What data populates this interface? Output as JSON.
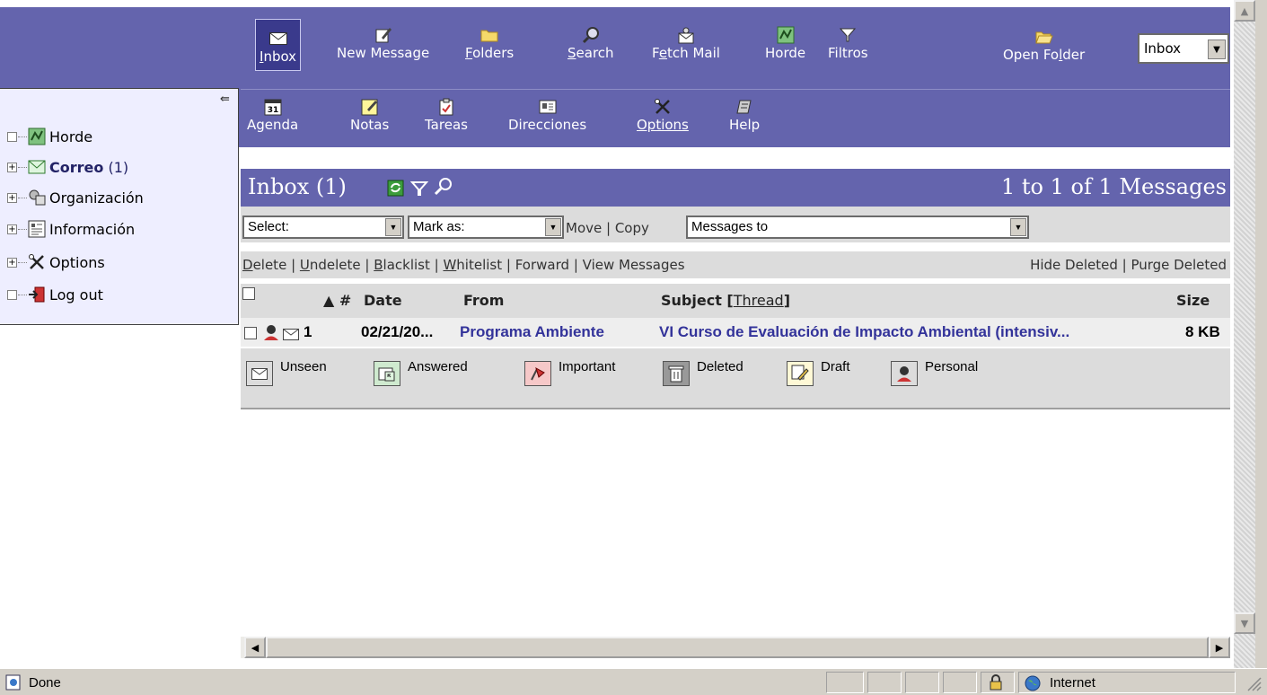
{
  "toolbar": {
    "row1": [
      {
        "name": "inbox",
        "icon": "envelope-icon",
        "prefix": "",
        "underline": "I",
        "suffix": "nbox"
      },
      {
        "name": "new-message",
        "icon": "compose-icon",
        "prefix": "",
        "underline": "",
        "suffix": "New Message"
      },
      {
        "name": "folders",
        "icon": "folder-icon",
        "prefix": "",
        "underline": "F",
        "suffix": "olders"
      },
      {
        "name": "search",
        "icon": "search-icon",
        "prefix": "",
        "underline": "S",
        "suffix": "earch"
      },
      {
        "name": "fetch-mail",
        "icon": "fetch-mail-icon",
        "prefix": "F",
        "underline": "e",
        "suffix": "tch Mail"
      },
      {
        "name": "horde",
        "icon": "horde-icon",
        "prefix": "",
        "underline": "",
        "suffix": "Horde"
      },
      {
        "name": "filtros",
        "icon": "filter-icon",
        "prefix": "",
        "underline": "",
        "suffix": "Filtros"
      }
    ],
    "row2": [
      {
        "name": "agenda",
        "icon": "calendar-icon",
        "label": "Agenda",
        "badge": "31"
      },
      {
        "name": "notas",
        "icon": "notes-icon",
        "label": "Notas"
      },
      {
        "name": "tareas",
        "icon": "tasks-icon",
        "label": "Tareas"
      },
      {
        "name": "direcciones",
        "icon": "address-book-icon",
        "label": "Direcciones"
      },
      {
        "name": "options",
        "icon": "tools-icon",
        "label": "Options"
      },
      {
        "name": "help",
        "icon": "help-icon",
        "label": "Help"
      }
    ],
    "open_folder": {
      "prefix": "Open Fo",
      "underline": "l",
      "suffix": "der"
    },
    "folder_select": "Inbox"
  },
  "sidebar": {
    "items": [
      {
        "name": "horde",
        "expander": "",
        "icon": "horde-icon",
        "label": "Horde",
        "count": ""
      },
      {
        "name": "correo",
        "expander": "+",
        "icon": "mail-icon",
        "label": "Correo",
        "count": "(1)"
      },
      {
        "name": "organizacion",
        "expander": "+",
        "icon": "organization-icon",
        "label": "Organización",
        "count": ""
      },
      {
        "name": "informacion",
        "expander": "+",
        "icon": "information-icon",
        "label": "Información",
        "count": ""
      },
      {
        "name": "options",
        "expander": "+",
        "icon": "tools-icon",
        "label": "Options",
        "count": ""
      },
      {
        "name": "logout",
        "expander": "",
        "icon": "logout-icon",
        "label": "Log out",
        "count": ""
      }
    ]
  },
  "mailbox": {
    "title": "Inbox (1)",
    "count": "1 to 1 of 1 Messages",
    "select_label": "Select:",
    "mark_label": "Mark as:",
    "move_label": "Move",
    "copy_label": "Copy",
    "target_label": "Messages to",
    "actions_left": [
      {
        "u": "D",
        "rest": "elete"
      },
      {
        "u": "U",
        "rest": "ndelete"
      },
      {
        "u": "B",
        "rest": "lacklist"
      },
      {
        "u": "W",
        "rest": "hitelist"
      },
      {
        "u": "",
        "rest": "Forward"
      },
      {
        "u": "",
        "rest": "View Messages"
      }
    ],
    "hide_deleted": "Hide Deleted",
    "purge_deleted": "Purge Deleted",
    "columns": {
      "number": "▲ #",
      "date": "Date",
      "from": "From",
      "subject": "Subject",
      "thread": "Thread",
      "size": "Size"
    },
    "messages": [
      {
        "number": "1",
        "date": "02/21/20...",
        "from": "Programa Ambiente",
        "subject": "VI Curso de Evaluación de Impacto Ambiental (intensiv...",
        "size": "8 KB"
      }
    ]
  },
  "legend": [
    {
      "name": "unseen",
      "label": "Unseen",
      "bg": "#ffffff"
    },
    {
      "name": "answered",
      "label": "Answered",
      "bg": "#cfeacf"
    },
    {
      "name": "important",
      "label": "Important",
      "bg": "#f6c8c8"
    },
    {
      "name": "deleted",
      "label": "Deleted",
      "bg": "#999999"
    },
    {
      "name": "draft",
      "label": "Draft",
      "bg": "#fff9d6"
    },
    {
      "name": "personal",
      "label": "Personal",
      "bg": "#ffffff"
    }
  ],
  "status": {
    "text": "Done",
    "zone": "Internet"
  },
  "colors": {
    "accent": "#6464ad",
    "link": "#33339a",
    "panel": "#dcdcdc",
    "sidebar": "#eeeeff"
  }
}
